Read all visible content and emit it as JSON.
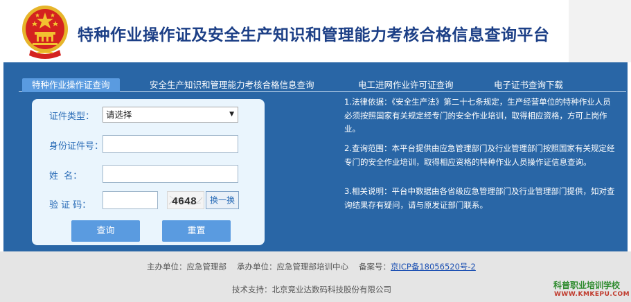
{
  "header": {
    "title": "特种作业操作证及安全生产知识和管理能力考核合格信息查询平台"
  },
  "tabs": [
    {
      "label": "特种作业操作证查询",
      "active": true
    },
    {
      "label": "安全生产知识和管理能力考核合格信息查询",
      "active": false
    },
    {
      "label": "电工进网作业许可证查询",
      "active": false
    },
    {
      "label": "电子证书查询下载",
      "active": false
    }
  ],
  "form": {
    "cert_type_label": "证件类型：",
    "cert_type_selected": "请选择",
    "id_label": "身份证件号：",
    "id_value": "",
    "name_label": "姓  名：",
    "name_value": "",
    "code_label": "验 证 码：",
    "code_value": "",
    "captcha_text": "4648",
    "refresh_label": "换一换",
    "query_label": "查询",
    "reset_label": "重置"
  },
  "notes": [
    "1.法律依据：《安全生产法》第二十七条规定，生产经营单位的特种作业人员必须按照国家有关规定经专门的安全作业培训，取得相应资格，方可上岗作业。",
    "2.查询范围：本平台提供由应急管理部门及行业管理部门按照国家有关规定经专门的安全作业培训，取得相应资格的特种作业人员操作证信息查询。",
    "3.相关说明：平台中数据由各省级应急管理部门及行业管理部门提供，如对查询结果存有疑问，请与原发证部门联系。"
  ],
  "footer": {
    "sponsor": "主办单位：应急管理部",
    "organizer": "承办单位：应急管理部培训中心",
    "icp_label": "备案号：",
    "icp_link": "京ICP备18056520号-2",
    "tech_support": "技术支持：北京竞业达数码科技股份有限公司"
  },
  "watermark": {
    "name": "科普职业培训学校",
    "url": "WWW.KMKEPU.COM"
  },
  "colors": {
    "title": "#1c3f86",
    "band": "#2966a6",
    "accent": "#5a9be0",
    "label": "#2a6cb7",
    "emblem_red": "#d4221f",
    "emblem_gold": "#f2c230"
  }
}
